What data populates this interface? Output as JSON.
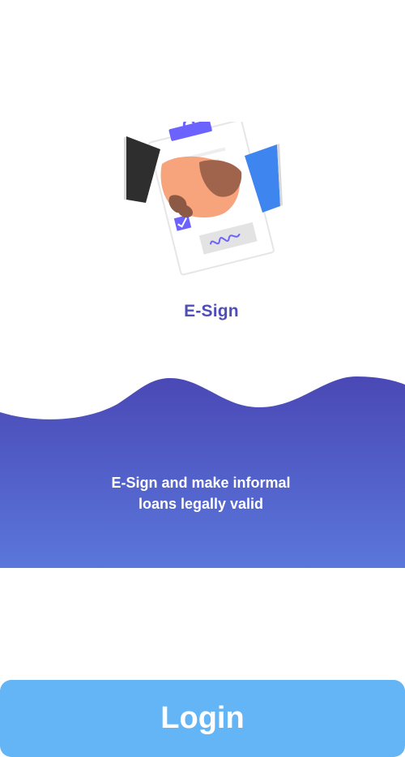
{
  "illustration": {
    "icon": "handshake-contract-icon"
  },
  "feature": {
    "title": "E-Sign",
    "description_line1": "E-Sign and make informal",
    "description_line2": "loans legally valid"
  },
  "login": {
    "label": "Login"
  },
  "colors": {
    "title": "#4f4db7",
    "wave_top": "#4a48b5",
    "wave_bottom": "#5a77dc",
    "button": "#63b5f6",
    "button_text": "#ffffff"
  }
}
